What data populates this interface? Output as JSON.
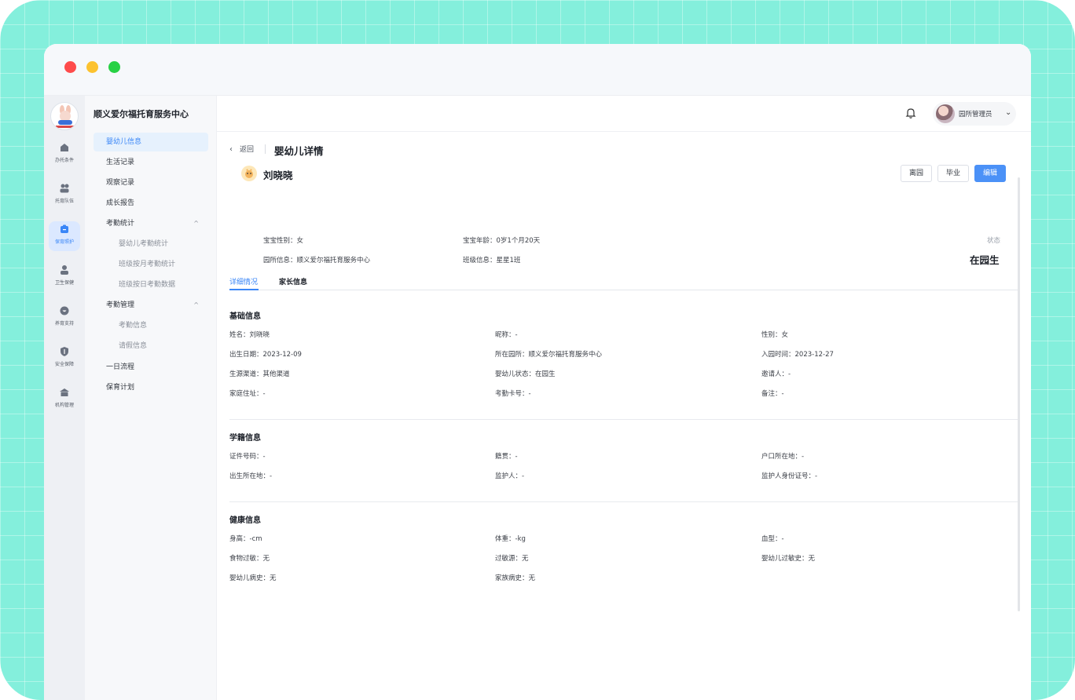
{
  "window": {
    "title": ""
  },
  "rail": {
    "items": [
      {
        "label": "办托条件",
        "icon": "building-icon"
      },
      {
        "label": "托育队伍",
        "icon": "team-icon"
      },
      {
        "label": "保育照护",
        "icon": "care-icon",
        "active": true
      },
      {
        "label": "卫生保健",
        "icon": "health-icon"
      },
      {
        "label": "养育支持",
        "icon": "support-icon"
      },
      {
        "label": "安全保障",
        "icon": "shield-icon"
      },
      {
        "label": "机构管理",
        "icon": "institution-icon"
      }
    ]
  },
  "menu": {
    "org_name": "顺义爱尔福托育服务中心",
    "items": [
      {
        "label": "婴幼儿信息",
        "active": true
      },
      {
        "label": "生活记录"
      },
      {
        "label": "观察记录"
      },
      {
        "label": "成长报告"
      },
      {
        "label": "考勤统计",
        "expandable": true
      },
      {
        "label": "婴幼儿考勤统计",
        "sub": true
      },
      {
        "label": "班级按月考勤统计",
        "sub": true
      },
      {
        "label": "班级按日考勤数据",
        "sub": true
      },
      {
        "label": "考勤管理",
        "expandable": true
      },
      {
        "label": "考勤信息",
        "sub": true
      },
      {
        "label": "请假信息",
        "sub": true
      },
      {
        "label": "一日流程"
      },
      {
        "label": "保育计划"
      }
    ],
    "collapse_glyph": "^"
  },
  "header": {
    "user_name": "园所管理员",
    "user_chevron": "⌄"
  },
  "detail": {
    "back_label": "返回",
    "page_title": "婴幼儿详情",
    "child_name": "刘晓晓",
    "buttons": {
      "leave": "离园",
      "graduate": "毕业",
      "edit": "编辑"
    },
    "summary": {
      "gender_key": "宝宝性别：",
      "gender_val": "女",
      "age_key": "宝宝年龄：",
      "age_val": "0岁1个月20天",
      "school_key": "园所信息：",
      "school_val": "顺义爱尔福托育服务中心",
      "class_key": "班级信息：",
      "class_val": "星星1班"
    },
    "status_label": "状态",
    "status_value": "在园生",
    "tabs": [
      "详细情况",
      "家长信息"
    ]
  },
  "sections": {
    "basic": {
      "title": "基础信息",
      "fields": [
        "姓名：刘晓晓",
        "昵称：-",
        "性别：女",
        "出生日期：2023-12-09",
        "所在园所：顺义爱尔福托育服务中心",
        "入园时间：2023-12-27",
        "生源渠道：其他渠道",
        "婴幼儿状态：在园生",
        "邀请人：-",
        "家庭住址：-",
        "考勤卡号：-",
        "备注：-"
      ]
    },
    "enrollment": {
      "title": "学籍信息",
      "fields": [
        "证件号码：-",
        "籍贯：-",
        "户口所在地：-",
        "出生所在地：-",
        "监护人：-",
        "监护人身份证号：-"
      ]
    },
    "health": {
      "title": "健康信息",
      "fields": [
        "身高：-cm",
        "体重：-kg",
        "血型：-",
        "食物过敏：无",
        "过敏源：无",
        "婴幼儿过敏史：无",
        "婴幼儿病史：无",
        "家族病史：无"
      ]
    }
  }
}
